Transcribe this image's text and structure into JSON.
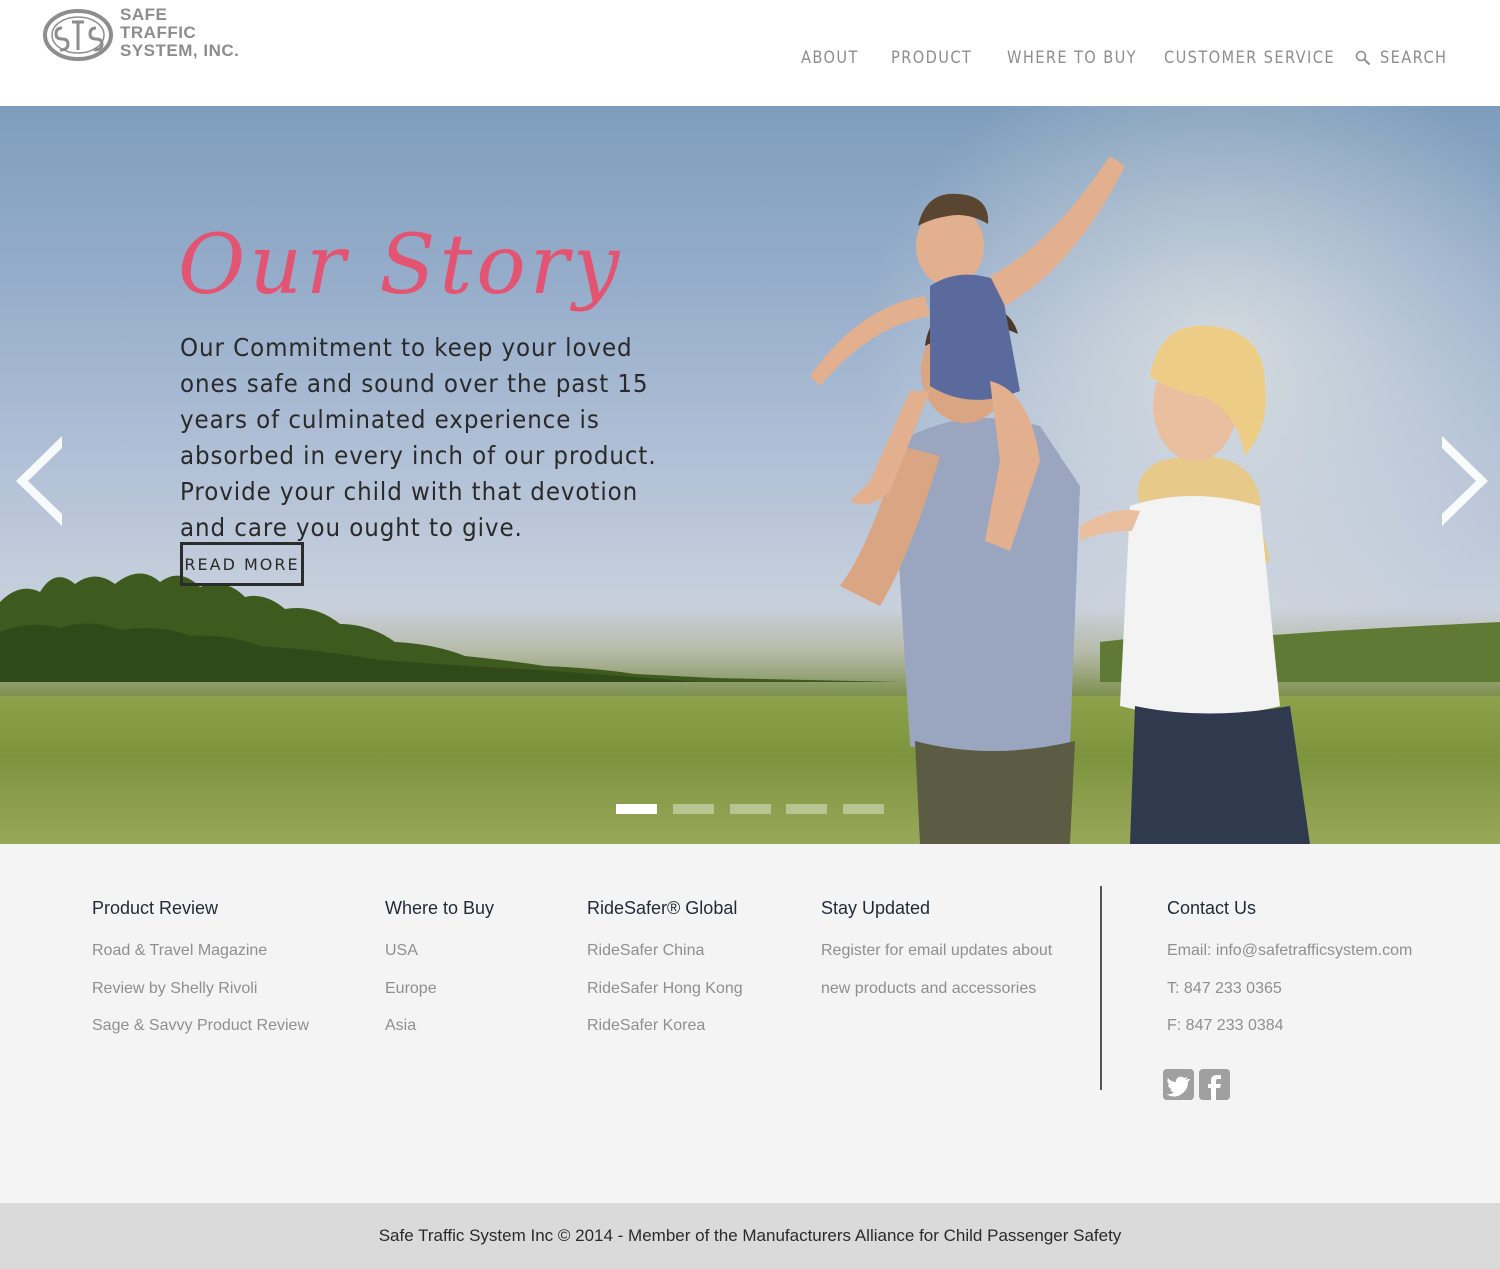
{
  "brand": {
    "logo_lines": [
      "SAFE",
      "TRAFFIC",
      "SYSTEM, INC."
    ],
    "logo_mark": "STS"
  },
  "nav": {
    "items": [
      "ABOUT",
      "PRODUCT",
      "WHERE TO BUY",
      "CUSTOMER SERVICE"
    ],
    "search_label": "SEARCH"
  },
  "hero": {
    "title": "Our Story",
    "body": "Our Commitment to keep your loved ones safe and sound over the past 15 years of culminated experience is absorbed in every inch of our product. Provide your child with that devotion and care you ought to give.",
    "button": "READ MORE",
    "slide_count": 5,
    "active_slide": 1
  },
  "footer": {
    "columns": [
      {
        "heading": "Product Review",
        "links": [
          "Road & Travel Magazine",
          "Review by Shelly Rivoli",
          "Sage & Savvy Product Review"
        ]
      },
      {
        "heading": "Where to Buy",
        "links": [
          "USA",
          "Europe",
          "Asia"
        ]
      },
      {
        "heading": "RideSafer® Global",
        "links": [
          "RideSafer China",
          "RideSafer Hong Kong",
          "RideSafer Korea"
        ]
      },
      {
        "heading": "Stay Updated",
        "links": [
          "Register for email updates about",
          "new products and accessories"
        ]
      },
      {
        "heading": "Contact Us",
        "links": [
          "Email: info@safetrafficsystem.com",
          "T: 847 233 0365",
          "F: 847 233 0384"
        ]
      }
    ],
    "social": [
      "twitter-icon",
      "facebook-icon"
    ],
    "copyright": "Safe Traffic System Inc © 2014 - Member of the Manufacturers Alliance for Child Passenger Safety"
  },
  "colors": {
    "accent": "#e35372",
    "nav_text": "#8e8e8e",
    "footer_bg": "#f4f4f4",
    "copyright_bg": "#dadadb"
  }
}
